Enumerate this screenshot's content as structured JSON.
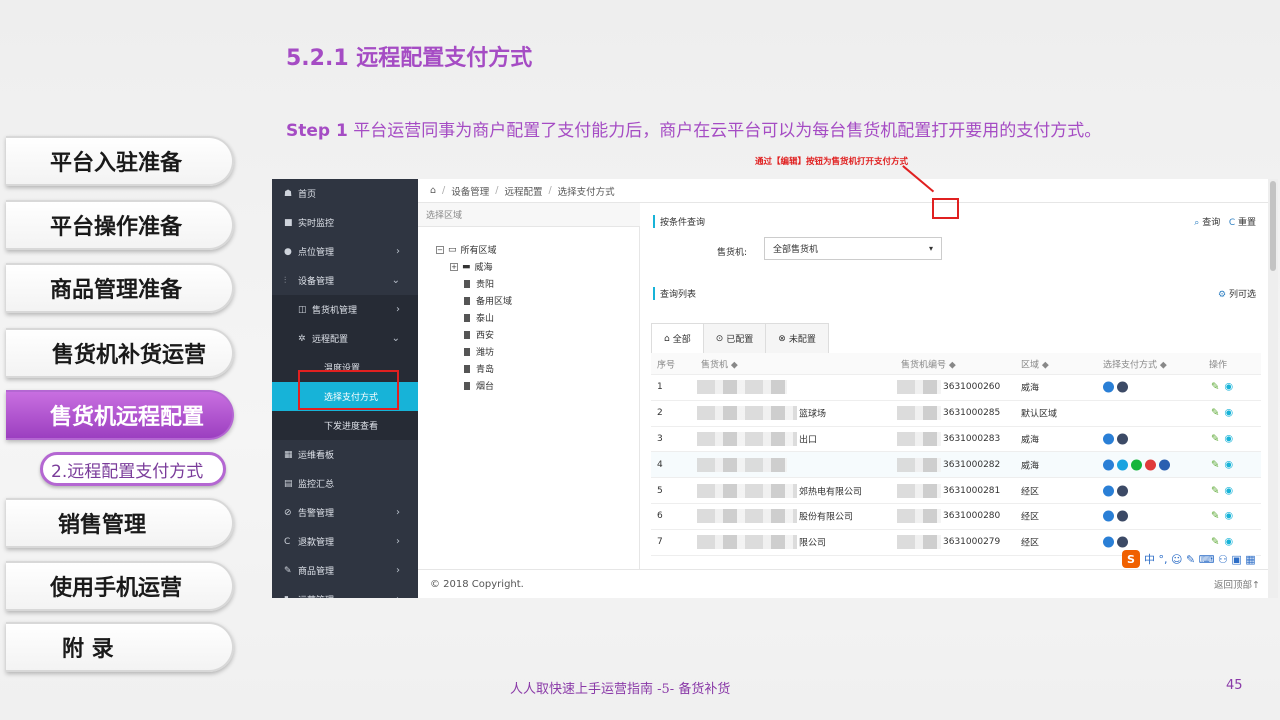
{
  "slide": {
    "title": "5.2.1 远程配置支付方式",
    "step_label": "Step 1",
    "step_text": " 平台运营同事为商户配置了支付能力后，商户在云平台可以为每台售货机配置打开要用的支付方式。",
    "footer_text": "人人取快速上手运营指南 -5- 备货补货",
    "page_number": "45"
  },
  "chapters": [
    {
      "label": "平台入驻准备"
    },
    {
      "label": "平台操作准备"
    },
    {
      "label": "商品管理准备"
    },
    {
      "label": "售货机补货运营"
    },
    {
      "label": "售货机远程配置"
    },
    {
      "label": "销售管理"
    },
    {
      "label": "使用手机运营"
    },
    {
      "label": "附 录"
    }
  ],
  "active_chapter_sub": "2.远程配置支付方式",
  "app": {
    "sidebar": [
      {
        "icon": "home-icon",
        "glyph": "☗",
        "label": "首页",
        "chevron": ""
      },
      {
        "icon": "video-icon",
        "glyph": "■",
        "label": "实时监控",
        "chevron": ""
      },
      {
        "icon": "pin-icon",
        "glyph": "●",
        "label": "点位管理",
        "chevron": "›"
      },
      {
        "icon": "equipment-icon",
        "glyph": "⫶",
        "label": "设备管理",
        "chevron": "⌄"
      },
      {
        "icon": "machine-icon",
        "glyph": "◫",
        "label": "售货机管理",
        "chevron": "›"
      },
      {
        "icon": "cogs-icon",
        "glyph": "✲",
        "label": "远程配置",
        "chevron": "⌄"
      },
      {
        "icon": "",
        "glyph": "",
        "label": "温度设置",
        "chevron": ""
      },
      {
        "icon": "",
        "glyph": "",
        "label": "选择支付方式",
        "chevron": ""
      },
      {
        "icon": "",
        "glyph": "",
        "label": "下发进度查看",
        "chevron": ""
      },
      {
        "icon": "calendar-icon",
        "glyph": "▦",
        "label": "运维看板",
        "chevron": ""
      },
      {
        "icon": "report-icon",
        "glyph": "▤",
        "label": "监控汇总",
        "chevron": ""
      },
      {
        "icon": "alarm-icon",
        "glyph": "⊘",
        "label": "告警管理",
        "chevron": "›"
      },
      {
        "icon": "refund-icon",
        "glyph": "C",
        "label": "退款管理",
        "chevron": "›"
      },
      {
        "icon": "edit-icon",
        "glyph": "✎",
        "label": "商品管理",
        "chevron": "›"
      },
      {
        "icon": "bookmark-icon",
        "glyph": "▮",
        "label": "运营管理",
        "chevron": "›"
      }
    ],
    "breadcrumb": [
      "设备管理",
      "远程配置",
      "选择支付方式"
    ],
    "tree": {
      "header": "选择区域",
      "root": "所有区域",
      "group": "威海",
      "leaves": [
        "贵阳",
        "备用区域",
        "泰山",
        "西安",
        "潍坊",
        "青岛",
        "烟台"
      ]
    },
    "query": {
      "section_title": "按条件查询",
      "search_label": "查询",
      "reset_label": "重置",
      "machine_label": "售货机:",
      "machine_value": "全部售货机"
    },
    "list": {
      "section_title": "查询列表",
      "columns_toggle": "列可选",
      "tabs": [
        "全部",
        "已配置",
        "未配置"
      ],
      "headers": [
        "序号",
        "售货机 ◆",
        "售货机编号 ◆",
        "区域 ◆",
        "选择支付方式 ◆",
        "操作"
      ],
      "note": "通过【编辑】按钮为售货机打开支付方式",
      "rows": [
        {
          "no": "1",
          "name": "",
          "code": "3631000260",
          "area": "威海",
          "pays": [
            "#2a7fd6",
            "#3c4a66"
          ]
        },
        {
          "no": "2",
          "name": "篮球场",
          "code": "3631000285",
          "area": "默认区域",
          "pays": []
        },
        {
          "no": "3",
          "name": "出口",
          "code": "3631000283",
          "area": "威海",
          "pays": [
            "#2a7fd6",
            "#3c4a66"
          ]
        },
        {
          "no": "4",
          "name": "",
          "code": "3631000282",
          "area": "威海",
          "pays": [
            "#2a7fd6",
            "#19a3e0",
            "#15b53a",
            "#e03a3a",
            "#2a5fb0"
          ]
        },
        {
          "no": "5",
          "name": "郊热电有限公司",
          "code": "3631000281",
          "area": "经区",
          "pays": [
            "#2a7fd6",
            "#3c4a66"
          ]
        },
        {
          "no": "6",
          "name": "股份有限公司",
          "code": "3631000280",
          "area": "经区",
          "pays": [
            "#2a7fd6",
            "#3c4a66"
          ]
        },
        {
          "no": "7",
          "name": "限公司",
          "code": "3631000279",
          "area": "经区",
          "pays": [
            "#2a7fd6",
            "#3c4a66"
          ]
        }
      ]
    },
    "footer_copyright": "© 2018 Copyright.",
    "back_to_top": "返回顶部↑",
    "ime_text": "中 °, ☺ ✎ ⌨ ⚇ ▣ ▦"
  }
}
